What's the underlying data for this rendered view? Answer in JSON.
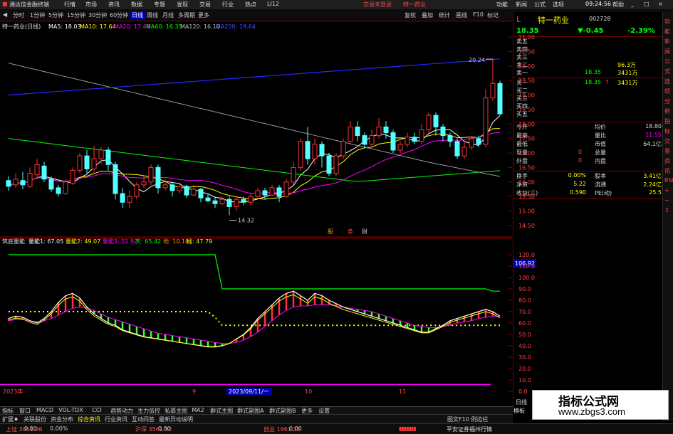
{
  "titlebar": {
    "app_title": "通达信金融终端",
    "menus": [
      "行情",
      "市场",
      "资讯",
      "数据",
      "专题",
      "发现",
      "交易",
      "行业",
      "热点",
      "LI12"
    ],
    "login_status": "交易未登录",
    "stock_title": "特一药业",
    "right_menus": [
      "功能",
      "新闻",
      "公式",
      "选项"
    ],
    "time": "09:24:56",
    "window_controls": [
      "帮助",
      "_",
      "□",
      "×"
    ]
  },
  "navbar": {
    "periods": [
      "分时",
      "1分钟",
      "5分钟",
      "15分钟",
      "30分钟",
      "60分钟",
      "日线",
      "周线",
      "月线",
      "多周期",
      "更多"
    ],
    "active_period": "日线",
    "toolbar": [
      "复权",
      "叠加",
      "统计",
      "画线",
      "F10",
      "标记"
    ]
  },
  "main_chart": {
    "header": {
      "label": "特一药业(日线)",
      "ma5": "MA5: 18.03",
      "ma10": "MA10: 17.64",
      "ma20": "MA20: 17.49",
      "ma60": "MA60: 16.35",
      "ma120": "MA120: 16.10",
      "ma250": "MA250: 19.64"
    },
    "y_ticks": [
      "21.00",
      "20.50",
      "20.00",
      "19.50",
      "19.00",
      "18.50",
      "18.00",
      "17.50",
      "17.00",
      "16.50",
      "16.00",
      "15.50",
      "15.00",
      "14.50"
    ],
    "y_min": 14.3,
    "y_max": 21.2,
    "high_label": "20.24",
    "low_label": "14.32",
    "event_markers": [
      "股",
      "条",
      "财"
    ],
    "colors": {
      "up": "#ff3232",
      "down": "#54ffff",
      "ma5": "#ffffff",
      "ma10": "#ffff00",
      "ma20": "#ff00ff",
      "ma60": "#00ff00",
      "ma120": "#999999",
      "ma250": "#2828ff"
    },
    "candles": [
      {
        "o": 16.05,
        "c": 15.85,
        "h": 16.2,
        "l": 15.7
      },
      {
        "o": 15.9,
        "c": 16.1,
        "h": 16.3,
        "l": 15.8
      },
      {
        "o": 16.05,
        "c": 15.9,
        "h": 16.35,
        "l": 15.75
      },
      {
        "o": 15.85,
        "c": 16.3,
        "h": 16.5,
        "l": 15.8
      },
      {
        "o": 16.25,
        "c": 16.6,
        "h": 16.8,
        "l": 16.1
      },
      {
        "o": 16.55,
        "c": 16.1,
        "h": 16.7,
        "l": 16.0
      },
      {
        "o": 16.1,
        "c": 15.75,
        "h": 16.2,
        "l": 15.65
      },
      {
        "o": 15.8,
        "c": 15.6,
        "h": 15.9,
        "l": 15.5
      },
      {
        "o": 15.6,
        "c": 16.0,
        "h": 16.1,
        "l": 15.55
      },
      {
        "o": 15.95,
        "c": 16.4,
        "h": 16.5,
        "l": 15.9
      },
      {
        "o": 16.4,
        "c": 16.9,
        "h": 17.0,
        "l": 16.3
      },
      {
        "o": 16.9,
        "c": 16.45,
        "h": 17.1,
        "l": 16.3
      },
      {
        "o": 16.45,
        "c": 16.8,
        "h": 17.25,
        "l": 16.3
      },
      {
        "o": 16.8,
        "c": 17.1,
        "h": 17.2,
        "l": 16.6
      },
      {
        "o": 17.1,
        "c": 16.6,
        "h": 17.2,
        "l": 16.4
      },
      {
        "o": 16.6,
        "c": 15.6,
        "h": 16.7,
        "l": 15.4
      },
      {
        "o": 15.6,
        "c": 15.3,
        "h": 15.8,
        "l": 15.1
      },
      {
        "o": 15.3,
        "c": 15.5,
        "h": 15.7,
        "l": 15.1
      },
      {
        "o": 15.5,
        "c": 15.9,
        "h": 16.0,
        "l": 15.4
      },
      {
        "o": 15.9,
        "c": 16.0,
        "h": 16.2,
        "l": 15.8
      },
      {
        "o": 16.0,
        "c": 16.5,
        "h": 16.6,
        "l": 15.9
      },
      {
        "o": 16.5,
        "c": 15.8,
        "h": 16.6,
        "l": 15.6
      },
      {
        "o": 15.8,
        "c": 15.9,
        "h": 16.1,
        "l": 15.7
      },
      {
        "o": 15.9,
        "c": 15.7,
        "h": 16.0,
        "l": 15.5
      },
      {
        "o": 15.7,
        "c": 15.85,
        "h": 15.95,
        "l": 15.6
      },
      {
        "o": 15.85,
        "c": 15.55,
        "h": 15.9,
        "l": 15.45
      },
      {
        "o": 15.55,
        "c": 15.75,
        "h": 15.9,
        "l": 15.5
      },
      {
        "o": 15.75,
        "c": 15.45,
        "h": 15.8,
        "l": 15.3
      },
      {
        "o": 15.45,
        "c": 15.35,
        "h": 15.6,
        "l": 15.3
      },
      {
        "o": 15.35,
        "c": 15.25,
        "h": 15.5,
        "l": 15.1
      },
      {
        "o": 15.25,
        "c": 15.4,
        "h": 15.5,
        "l": 15.2
      },
      {
        "o": 15.4,
        "c": 15.15,
        "h": 15.5,
        "l": 14.85
      },
      {
        "o": 15.15,
        "c": 15.4,
        "h": 15.5,
        "l": 15.0
      },
      {
        "o": 15.4,
        "c": 15.3,
        "h": 15.5,
        "l": 15.2
      },
      {
        "o": 15.3,
        "c": 15.5,
        "h": 15.6,
        "l": 15.2
      },
      {
        "o": 15.5,
        "c": 15.7,
        "h": 15.8,
        "l": 15.4
      },
      {
        "o": 15.7,
        "c": 15.55,
        "h": 15.8,
        "l": 15.4
      },
      {
        "o": 15.55,
        "c": 15.8,
        "h": 15.9,
        "l": 15.5
      },
      {
        "o": 15.8,
        "c": 15.5,
        "h": 15.9,
        "l": 15.3
      },
      {
        "o": 15.5,
        "c": 16.0,
        "h": 16.1,
        "l": 15.45
      },
      {
        "o": 16.0,
        "c": 16.5,
        "h": 16.7,
        "l": 15.9
      },
      {
        "o": 16.5,
        "c": 17.4,
        "h": 17.5,
        "l": 16.4
      },
      {
        "o": 17.4,
        "c": 16.8,
        "h": 17.9,
        "l": 16.6
      },
      {
        "o": 16.8,
        "c": 17.3,
        "h": 17.5,
        "l": 16.6
      },
      {
        "o": 17.3,
        "c": 16.9,
        "h": 17.4,
        "l": 16.5
      },
      {
        "o": 16.9,
        "c": 16.3,
        "h": 17.0,
        "l": 16.2
      },
      {
        "o": 16.3,
        "c": 16.9,
        "h": 17.0,
        "l": 16.2
      },
      {
        "o": 16.9,
        "c": 17.4,
        "h": 17.5,
        "l": 16.8
      },
      {
        "o": 17.4,
        "c": 17.9,
        "h": 18.1,
        "l": 17.3
      },
      {
        "o": 17.9,
        "c": 17.6,
        "h": 18.1,
        "l": 17.4
      },
      {
        "o": 17.6,
        "c": 17.3,
        "h": 17.7,
        "l": 17.2
      },
      {
        "o": 17.3,
        "c": 17.6,
        "h": 17.8,
        "l": 17.2
      },
      {
        "o": 17.6,
        "c": 17.9,
        "h": 18.2,
        "l": 17.5
      },
      {
        "o": 17.9,
        "c": 17.7,
        "h": 18.1,
        "l": 17.5
      },
      {
        "o": 17.7,
        "c": 17.1,
        "h": 17.8,
        "l": 17.0
      },
      {
        "o": 17.1,
        "c": 17.3,
        "h": 17.4,
        "l": 17.0
      },
      {
        "o": 17.3,
        "c": 17.55,
        "h": 17.7,
        "l": 17.2
      },
      {
        "o": 17.55,
        "c": 17.4,
        "h": 17.7,
        "l": 17.3
      },
      {
        "o": 17.4,
        "c": 17.8,
        "h": 18.0,
        "l": 17.3
      },
      {
        "o": 17.8,
        "c": 18.3,
        "h": 18.4,
        "l": 17.7
      },
      {
        "o": 18.3,
        "c": 17.9,
        "h": 18.4,
        "l": 17.6
      },
      {
        "o": 17.9,
        "c": 17.6,
        "h": 18.0,
        "l": 17.4
      },
      {
        "o": 17.6,
        "c": 17.4,
        "h": 17.7,
        "l": 17.2
      },
      {
        "o": 17.4,
        "c": 16.9,
        "h": 17.5,
        "l": 16.8
      },
      {
        "o": 16.9,
        "c": 17.2,
        "h": 17.4,
        "l": 16.8
      },
      {
        "o": 17.2,
        "c": 17.5,
        "h": 17.6,
        "l": 17.1
      },
      {
        "o": 17.5,
        "c": 17.3,
        "h": 17.6,
        "l": 17.2
      },
      {
        "o": 17.3,
        "c": 18.9,
        "h": 19.2,
        "l": 17.2
      },
      {
        "o": 18.9,
        "c": 19.4,
        "h": 20.24,
        "l": 18.8
      },
      {
        "o": 19.4,
        "c": 18.35,
        "h": 19.5,
        "l": 18.3
      }
    ]
  },
  "sub_chart": {
    "header": {
      "name": "筑底量能",
      "v1": "量能1: 67.05",
      "v2": "量能2: 49.07",
      "v3": "量能3: 51.92",
      "v4": "天: 65.42",
      "v5": "地: 10.18",
      "v6": "线: 47.79"
    },
    "y_ticks": [
      "120.0",
      "110.0",
      "100.0",
      "90.0",
      "80.0",
      "70.0",
      "60.0",
      "50.0",
      "40.0",
      "30.0",
      "20.0",
      "10.0",
      "0.0"
    ],
    "y_min": 0,
    "y_max": 125,
    "current_marker": "106.92",
    "x_labels": [
      "2023年",
      "9",
      "10",
      "11"
    ],
    "crosshair_date": "2023/09/11/一",
    "line1": [
      64,
      66,
      65,
      62,
      60,
      64,
      70,
      78,
      84,
      86,
      82,
      74,
      68,
      64,
      60,
      58,
      54,
      52,
      50,
      48,
      47,
      46,
      45,
      44,
      43,
      42,
      41,
      40,
      39,
      39,
      40,
      42,
      46,
      50,
      56,
      64,
      70,
      76,
      82,
      86,
      88,
      84,
      80,
      86,
      84,
      80,
      77,
      74,
      72,
      70,
      68,
      66,
      64,
      62,
      60,
      58,
      56,
      54,
      52,
      52,
      55,
      58,
      62,
      64,
      66,
      68,
      70,
      72,
      70,
      66
    ],
    "line2": [
      62,
      63,
      63,
      62,
      61,
      62,
      64,
      67,
      70,
      73,
      74,
      73,
      71,
      68,
      65,
      63,
      61,
      59,
      57,
      55,
      53,
      51,
      50,
      49,
      48,
      47,
      46,
      45,
      44,
      43,
      42,
      42,
      43,
      45,
      48,
      52,
      57,
      62,
      67,
      71,
      74,
      75,
      75,
      76,
      76,
      76,
      75,
      74,
      73,
      72,
      71,
      70,
      68,
      66,
      64,
      62,
      60,
      58,
      57,
      56,
      56,
      57,
      58,
      60,
      61,
      62,
      64,
      65,
      66,
      66
    ],
    "green_step": [
      120,
      120,
      120,
      120,
      120,
      120,
      120,
      120,
      120,
      120,
      120,
      120,
      120,
      120,
      120,
      120,
      120,
      120,
      120,
      120,
      120,
      120,
      120,
      120,
      120,
      120,
      120,
      120,
      120,
      120,
      90,
      90,
      90,
      90,
      90,
      90,
      90,
      90,
      90,
      90,
      90,
      90,
      90,
      90,
      90,
      90,
      90,
      90,
      90,
      90,
      90,
      90,
      90,
      90,
      90,
      90,
      90,
      90,
      90,
      90,
      90,
      90,
      90,
      90,
      90,
      90,
      90,
      90,
      88,
      88
    ],
    "yellow_dotted": [
      70,
      70,
      70,
      70,
      70,
      70,
      70,
      70,
      70,
      70,
      70,
      70,
      70,
      70,
      70,
      70,
      70,
      70,
      70,
      70,
      70,
      70,
      70,
      70,
      70,
      70,
      70,
      70,
      70,
      65,
      58,
      58,
      58,
      58,
      58,
      58,
      58,
      58,
      58,
      58,
      58,
      58,
      58,
      58,
      58,
      58,
      58,
      58,
      58,
      58,
      58,
      58,
      58,
      58,
      58,
      58,
      58,
      58,
      58,
      58,
      58,
      58,
      58,
      58,
      58,
      58,
      58,
      58,
      58,
      58
    ],
    "magenta_base": 6
  },
  "quote_panel": {
    "name": "特一药业",
    "code": "002728",
    "price": "18.35",
    "change": "▼-0.45",
    "change_pct": "-2.39%",
    "sell_levels": [
      {
        "label": "卖五",
        "price": "",
        "vol": ""
      },
      {
        "label": "卖四",
        "price": "",
        "vol": ""
      },
      {
        "label": "卖三",
        "price": "",
        "vol": ""
      },
      {
        "label": "卖二",
        "price": "",
        "vol": "96.3万"
      },
      {
        "label": "卖一",
        "price": "18.35",
        "vol": "3431万"
      }
    ],
    "buy_levels": [
      {
        "label": "买一",
        "price": "18.35",
        "arrow": "↑",
        "vol": "3431万"
      },
      {
        "label": "买二",
        "price": "",
        "vol": ""
      },
      {
        "label": "买三",
        "price": "",
        "vol": ""
      },
      {
        "label": "买四",
        "price": "",
        "vol": ""
      },
      {
        "label": "买五",
        "price": "",
        "vol": ""
      }
    ],
    "stats_left": [
      {
        "label": "今开",
        "value": ""
      },
      {
        "label": "最高",
        "value": ""
      },
      {
        "label": "最低",
        "value": ""
      },
      {
        "label": "现量",
        "value": "0"
      },
      {
        "label": "外盘",
        "value": "0"
      }
    ],
    "stats_right": [
      {
        "label": "均价",
        "value": "18.80"
      },
      {
        "label": "量比",
        "value": "11.55"
      },
      {
        "label": "市值",
        "value": "64.1亿"
      },
      {
        "label": "总量",
        "value": ""
      },
      {
        "label": "内盘",
        "value": ""
      }
    ],
    "fund_rows": [
      {
        "l1": "换手",
        "v1": "0.00%",
        "l2": "股本",
        "v2": "3.41亿"
      },
      {
        "l1": "净资",
        "v1": "5.22",
        "l2": "流通",
        "v2": "2.24亿"
      },
      {
        "l1": "收益(三)",
        "v1": "0.590",
        "l2": "PE(动)",
        "v2": "25.5"
      }
    ],
    "bottom_tab": "日线",
    "bottom_label": "模板"
  },
  "side_strip": [
    "功",
    "能",
    "新",
    "闻",
    "公",
    "式",
    "选",
    "项",
    "分",
    "析",
    "指",
    "标",
    "交",
    "易",
    "资",
    "讯",
    "RSI",
    "+",
    "−",
    "↕"
  ],
  "bottom_tabs_1": [
    "指标",
    "窗口",
    "MACD",
    "VOL-TDX",
    "CCI",
    "趋势动力",
    "主力监控",
    "私募主图",
    "MA2",
    "群式主图",
    "群式副图A",
    "群式副图B",
    "更多",
    "设置"
  ],
  "bottom_tabs_2": [
    "扩展♦",
    "关联股份",
    "资金分布",
    "综合资讯",
    "行业资讯",
    "互动问答",
    "最新异动说明"
  ],
  "bottom_tabs_2_right": "图文F10 例边栏",
  "statusbar": {
    "items": [
      {
        "label": "上证",
        "value": "3061.86",
        "color": "#ff5555"
      },
      {
        "label": "",
        "value": "0.00",
        "color": "#ccc"
      },
      {
        "label": "",
        "value": "0.00%",
        "color": "#ccc"
      },
      {
        "label": "沪深",
        "value": "3561.52",
        "color": "#ff5555"
      },
      {
        "label": "",
        "value": "0.00",
        "color": "#ccc"
      },
      {
        "label": "创业",
        "value": "1961.35",
        "color": "#ff5555"
      },
      {
        "label": "",
        "value": "0.00",
        "color": "#ccc"
      }
    ],
    "broker": "平安证券福州行情"
  },
  "watermark": {
    "text1": "指标公式网",
    "text2": "www.zbgs3.com"
  }
}
